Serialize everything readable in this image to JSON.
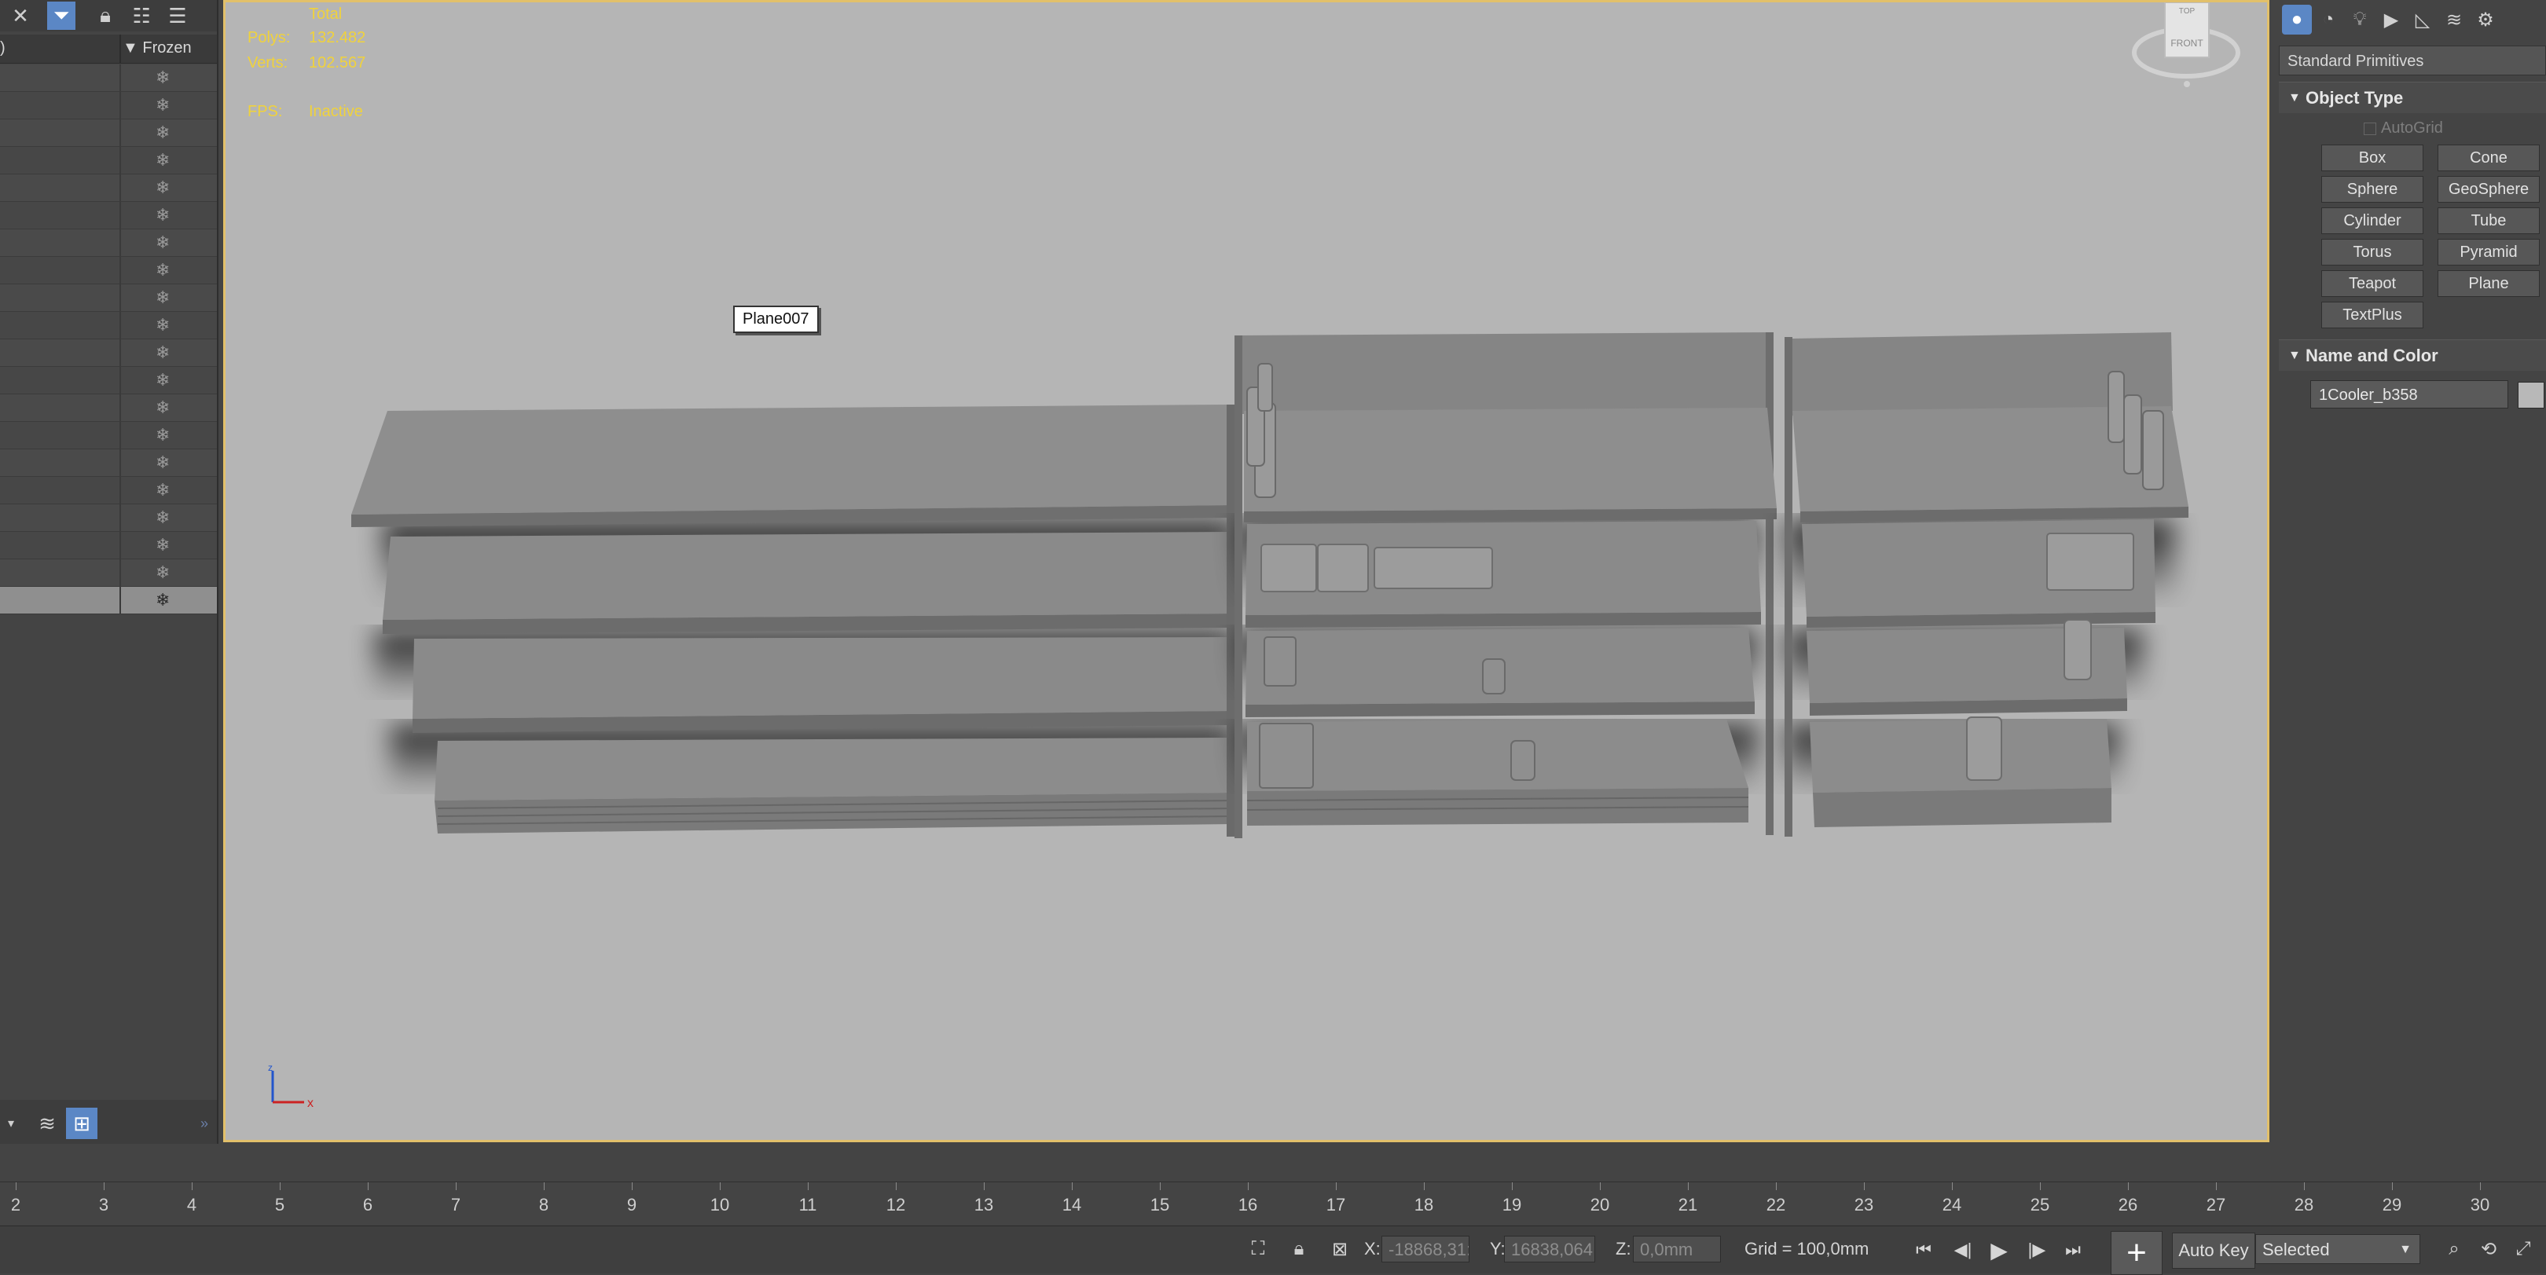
{
  "explorer": {
    "header_left": ")",
    "header_right": "Frozen",
    "freeze_glyph": "❄",
    "row_count": 20,
    "selected_row_index": 19,
    "toolbar_icons": [
      "close-icon",
      "filter-icon",
      "lock-icon",
      "hierarchy-icon",
      "hierarchy-alt-icon"
    ],
    "bottom_icons": [
      "dropdown-arrow-icon",
      "layers-icon",
      "hierarchy-sort-icon"
    ],
    "expand_glyph": "»"
  },
  "viewport": {
    "stats": {
      "total_label": "Total",
      "polys_label": "Polys:",
      "polys_value": "132.482",
      "verts_label": "Verts:",
      "verts_value": "102.567",
      "fps_label": "FPS:",
      "fps_value": "Inactive"
    },
    "object_label": "Plane007",
    "viewcube": {
      "front": "FRONT",
      "top": "TOP"
    },
    "axis": {
      "x": "x",
      "z": "z"
    }
  },
  "command_panel": {
    "tab_icons": [
      "geometry-icon",
      "shapes-icon",
      "lights-icon",
      "cameras-icon",
      "helpers-icon",
      "spacewarps-icon",
      "systems-icon"
    ],
    "category": "Standard Primitives",
    "object_type": {
      "title": "Object Type",
      "autogrid": "AutoGrid",
      "buttons": [
        "Box",
        "Cone",
        "Sphere",
        "GeoSphere",
        "Cylinder",
        "Tube",
        "Torus",
        "Pyramid",
        "Teapot",
        "Plane",
        "TextPlus"
      ]
    },
    "name_and_color": {
      "title": "Name and Color",
      "name": "1Cooler_b358",
      "color": "#b8b8b8"
    }
  },
  "timeline": {
    "ticks": [
      "2",
      "3",
      "4",
      "5",
      "6",
      "7",
      "8",
      "9",
      "10",
      "11",
      "12",
      "13",
      "14",
      "15",
      "16",
      "17",
      "18",
      "19",
      "20",
      "21",
      "22",
      "23",
      "24",
      "25",
      "26",
      "27",
      "28",
      "29",
      "30"
    ]
  },
  "statusbar": {
    "x_label": "X:",
    "x_value": "-18868,31:",
    "y_label": "Y:",
    "y_value": "16838,064",
    "z_label": "Z:",
    "z_value": "0,0mm",
    "grid": "Grid = 100,0mm",
    "autokey": "Auto Key",
    "selection": "Selected",
    "add_key_glyph": "+"
  },
  "colors": {
    "accent": "#5b87c5",
    "viewport_border": "#e2c06a",
    "stats_text": "#f0d23c",
    "viewport_bg": "#b5b5b5"
  }
}
